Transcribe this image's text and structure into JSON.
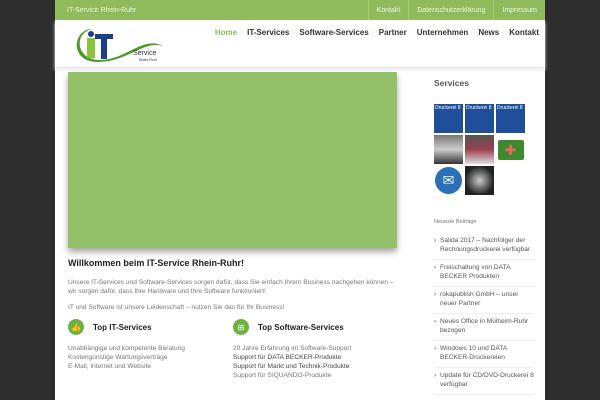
{
  "topbar": {
    "site": "IT-Service Rhein-Ruhr",
    "links": [
      "Kontakt",
      "Datenschutzerklärung",
      "Impressum"
    ]
  },
  "logo": {
    "text": "iT",
    "sub": "Service",
    "sub2": "Rhein-Ruhr"
  },
  "nav": [
    "Home",
    "IT-Services",
    "Software-Services",
    "Partner",
    "Unternehmen",
    "News",
    "Kontakt"
  ],
  "main": {
    "title": "Willkommen beim IT-Service Rhein-Ruhr!",
    "p1": "Unsere IT-Services und Software-Services sorgen dafür, dass Sie einfach Ihrem Business nachgehen können – wir sorgen dafür, dass Ihre Hardware und Ihre Software funktioniert!",
    "p2": "IT und Software ist unsere Leidenschaft – nutzen Sie das für Ihr Business!",
    "col1": {
      "title": "Top IT-Services",
      "items": [
        "Unabhängige und kompetente Beratung",
        "Kostengünstige Wartungsverträge",
        "E-Mail, Internet und Website"
      ]
    },
    "col2": {
      "title": "Top Software-Services",
      "items": [
        "20 Jahre Erfahrung im Software-Support",
        "Support für DATA BECKER-Produkte",
        "Support für Markt und Technik-Produkte",
        "Support für SIQUANDO-Produkte"
      ]
    }
  },
  "sidebar": {
    "title": "Services",
    "tiles": [
      "Druckerei 8",
      "Druckerei 8",
      "Druckerei 8"
    ],
    "recent_title": "Neueste Beiträge",
    "posts": [
      "Salida 2017 – Nachfolger der Rechnungsdruckerei verfügbar",
      "Freischaltung von DATA BECKER Produkten",
      "rokapublish GmbH – unser neuer Partner",
      "Neues Office in Mülheim-Ruhr bezogen",
      "Windows 10 und DATA BECKER-Druckereien",
      "Update für CD/DVD-Druckerei 8 verfügbar"
    ]
  }
}
